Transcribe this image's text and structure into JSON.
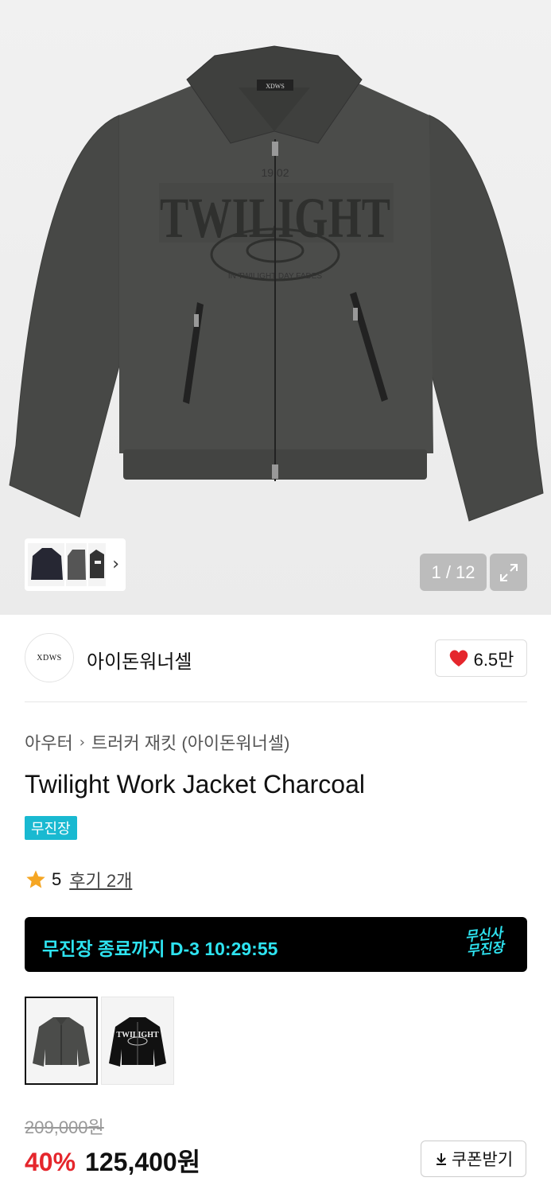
{
  "gallery": {
    "counter": "1 / 12",
    "jacket_label": "XDWS",
    "jacket_print": "TWILIGHT",
    "jacket_print_top": "19 02",
    "jacket_print_arc": "IN TWILIGHT DAY FADES",
    "thumb_next_icon": "chevron-right-icon",
    "expand_icon": "expand-icon"
  },
  "brand": {
    "logo_text": "XDWS",
    "name": "아이돈워너셀",
    "like_count": "6.5만",
    "like_icon": "heart-icon",
    "like_color": "#e5262c"
  },
  "breadcrumb": {
    "level1": "아우터",
    "level2": "트러커 재킷 (아이돈워너셀)"
  },
  "product": {
    "title": "Twilight Work Jacket Charcoal",
    "badge": "무진장",
    "badge_color": "#19b9d1",
    "rating": "5",
    "reviews": "후기 2개"
  },
  "promo": {
    "countdown": "무진장 종료까지 D-3 10:29:55",
    "logo_line1": "무신사",
    "logo_line2": "무진장",
    "accent": "#2ee3f0"
  },
  "swatches": [
    {
      "name": "Charcoal",
      "selected": true
    },
    {
      "name": "Black",
      "selected": false
    }
  ],
  "swatch_print": "TWILIGHT",
  "price": {
    "original": "209,000원",
    "discount": "40%",
    "sale": "125,400원",
    "coupon_label": "쿠폰받기",
    "coupon_icon": "download-icon"
  }
}
